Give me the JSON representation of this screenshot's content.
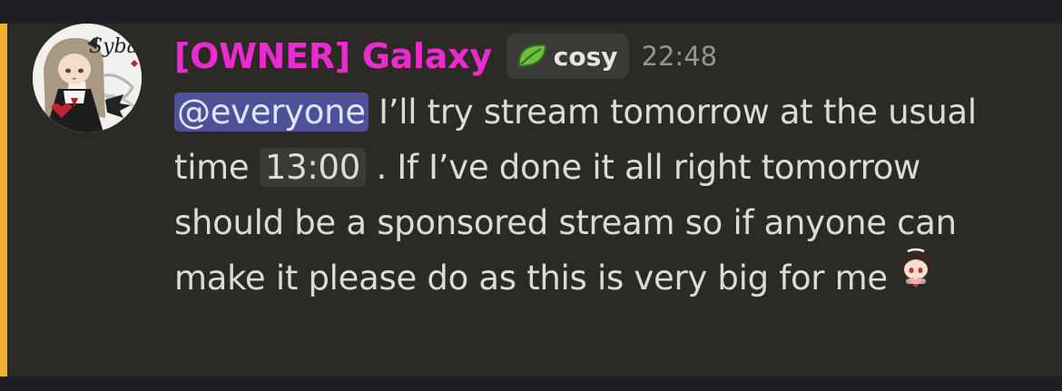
{
  "message": {
    "author": "[OWNER] Galaxy",
    "author_color": "#ea2bcf",
    "avatar_text": "Sybau",
    "tag": {
      "icon": "leaf-icon",
      "label": "cosy"
    },
    "timestamp": "22:48",
    "mention": "@everyone",
    "text_1": " I’ll try stream tomorrow at the usual time ",
    "time_chip": "13:00",
    "text_2": " . If I’ve done it all right tomorrow should be a sponsored stream so if anyone can make it please do as this is very big for me",
    "emoji": "chibi-heart-emoji"
  },
  "colors": {
    "background": "#1e1f24",
    "message_highlight": "#2c2a25",
    "mention_bar": "#f0b132",
    "mention_bg": "#4f5198",
    "text": "#dbdbd7",
    "timestamp": "#95948f"
  }
}
